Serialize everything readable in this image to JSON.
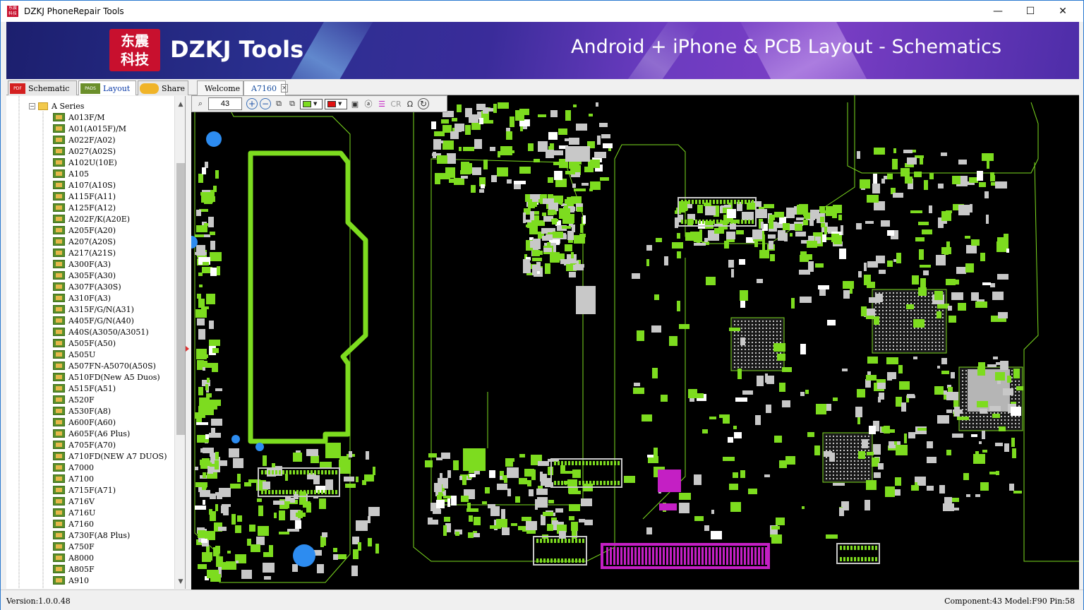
{
  "window": {
    "title": "DZKJ PhoneRepair Tools",
    "icon": "dzkj-app-icon",
    "controls": {
      "minimize": "—",
      "maximize": "☐",
      "close": "✕"
    }
  },
  "banner": {
    "logo_text": "东震\n科技",
    "brand": "DZKJ Tools",
    "tagline": "Android + iPhone & PCB Layout - Schematics"
  },
  "nav_tabs": [
    {
      "icon_text": "PDF",
      "label": "Schematic",
      "icon_color": "#d42020"
    },
    {
      "icon_text": "PADS",
      "label": "Layout",
      "icon_color": "#6b8f2a"
    },
    {
      "icon_text": "",
      "label": "Share",
      "icon_color": "#f0b429"
    }
  ],
  "doc_tabs": [
    {
      "label": "Welcome"
    },
    {
      "label": "A7160"
    }
  ],
  "tree": {
    "series_label": "A Series",
    "items": [
      "A013F/M",
      "A01(A015F)/M",
      "A022F/A02)",
      "A027(A02S)",
      "A102U(10E)",
      "A105",
      "A107(A10S)",
      "A115F(A11)",
      "A125F(A12)",
      "A202F/K(A20E)",
      "A205F(A20)",
      "A207(A20S)",
      "A217(A21S)",
      "A300F(A3)",
      "A305F(A30)",
      "A307F(A30S)",
      "A310F(A3)",
      "A315F/G/N(A31)",
      "A405F/G/N(A40)",
      "A40S(A3050/A3051)",
      "A505F(A50)",
      "A505U",
      "A507FN-A5070(A50S)",
      "A510FD(New A5 Duos)",
      "A515F(A51)",
      "A520F",
      "A530F(A8)",
      "A600F(A60)",
      "A605F(A6 Plus)",
      "A705F(A70)",
      "A710FD(NEW A7 DUOS)",
      "A7000",
      "A7100",
      "A715F(A71)",
      "A716V",
      "A716U",
      "A7160",
      "A730F(A8 Plus)",
      "A750F",
      "A8000",
      "A805F",
      "A910"
    ]
  },
  "toolbar": {
    "zoom_value": "43",
    "cr_label": "CR",
    "omega_label": "Ω",
    "colors": {
      "trace": "#7ddc1f",
      "highlight": "#e01010"
    }
  },
  "pcb_colors": {
    "trace": "#7ddc1f",
    "pad": "#c8c8c8",
    "selected": "#c41fc4",
    "testpoint": "#2d8cf0",
    "board": "#000000"
  },
  "status": {
    "version": "Version:1.0.0.48",
    "info": "Component:43 Model:F90 Pin:58"
  }
}
